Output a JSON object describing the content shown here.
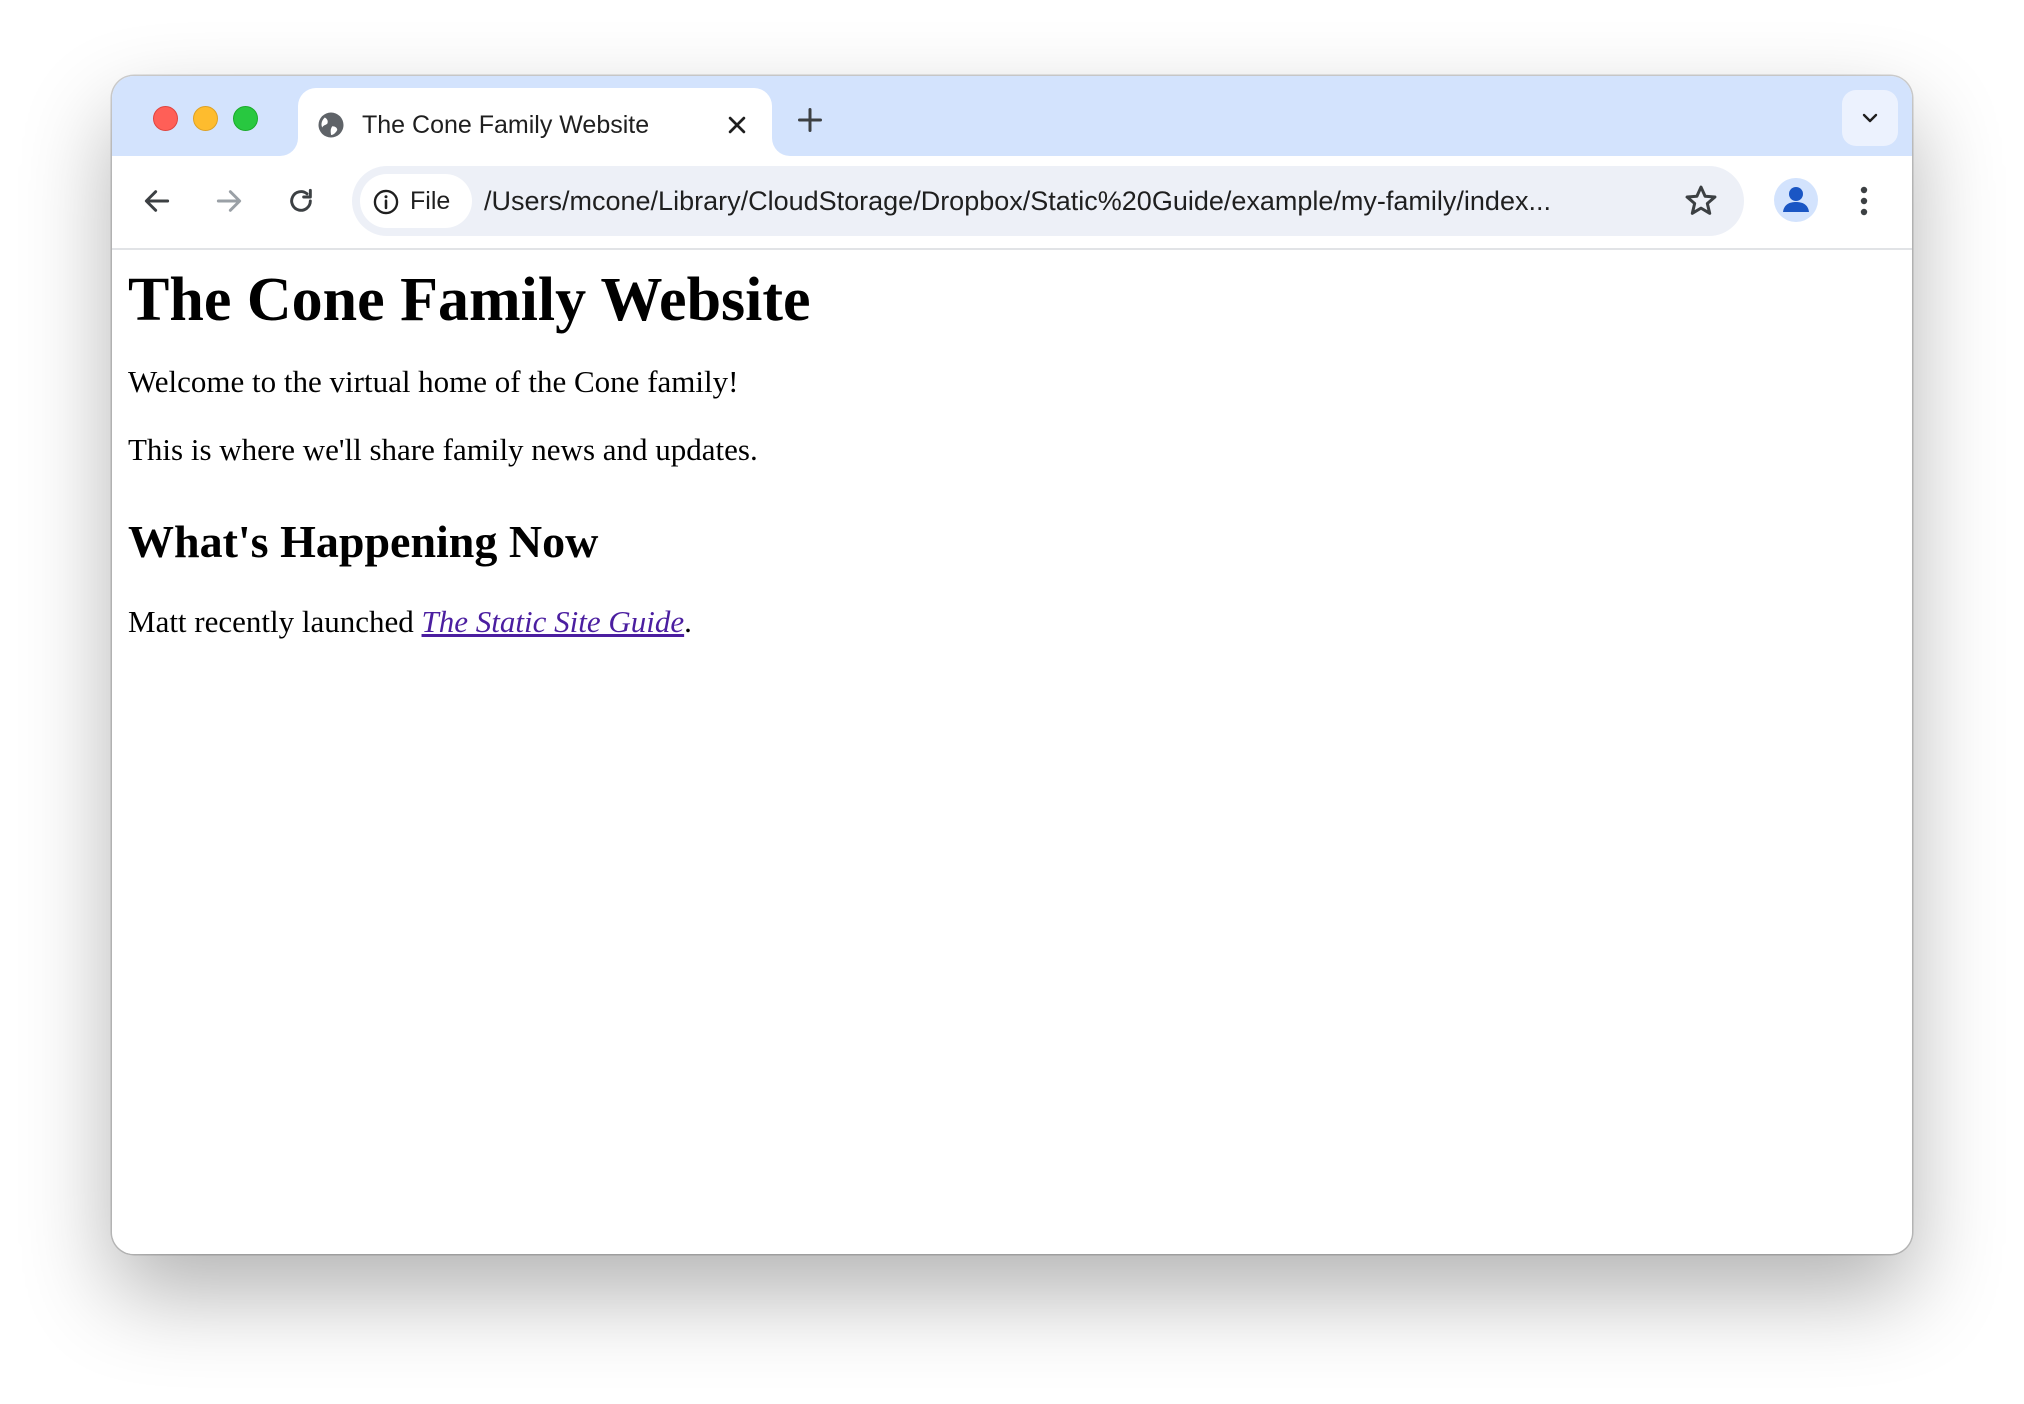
{
  "browser": {
    "tab": {
      "title": "The Cone Family Website",
      "favicon": "globe-icon"
    },
    "new_tab_icon": "plus-icon",
    "tab_search_icon": "chevron-down-icon",
    "toolbar": {
      "back_icon": "arrow-left-icon",
      "forward_icon": "arrow-right-icon",
      "reload_icon": "reload-icon",
      "site_info_label": "File",
      "url": "/Users/mcone/Library/CloudStorage/Dropbox/Static%20Guide/example/my-family/index...",
      "bookmark_icon": "star-icon",
      "profile_icon": "person-icon",
      "menu_icon": "kebab-menu-icon"
    }
  },
  "page": {
    "heading": "The Cone Family Website",
    "intro": "Welcome to the virtual home of the Cone family!",
    "description": "This is where we'll share family news and updates.",
    "subheading": "What's Happening Now",
    "news_prefix": "Matt recently launched ",
    "news_link": "The Static Site Guide",
    "news_suffix": "."
  },
  "colors": {
    "tabstrip": "#d3e3fd",
    "omnibox": "#edf0f7",
    "link_visited": "#4b1ea0"
  }
}
